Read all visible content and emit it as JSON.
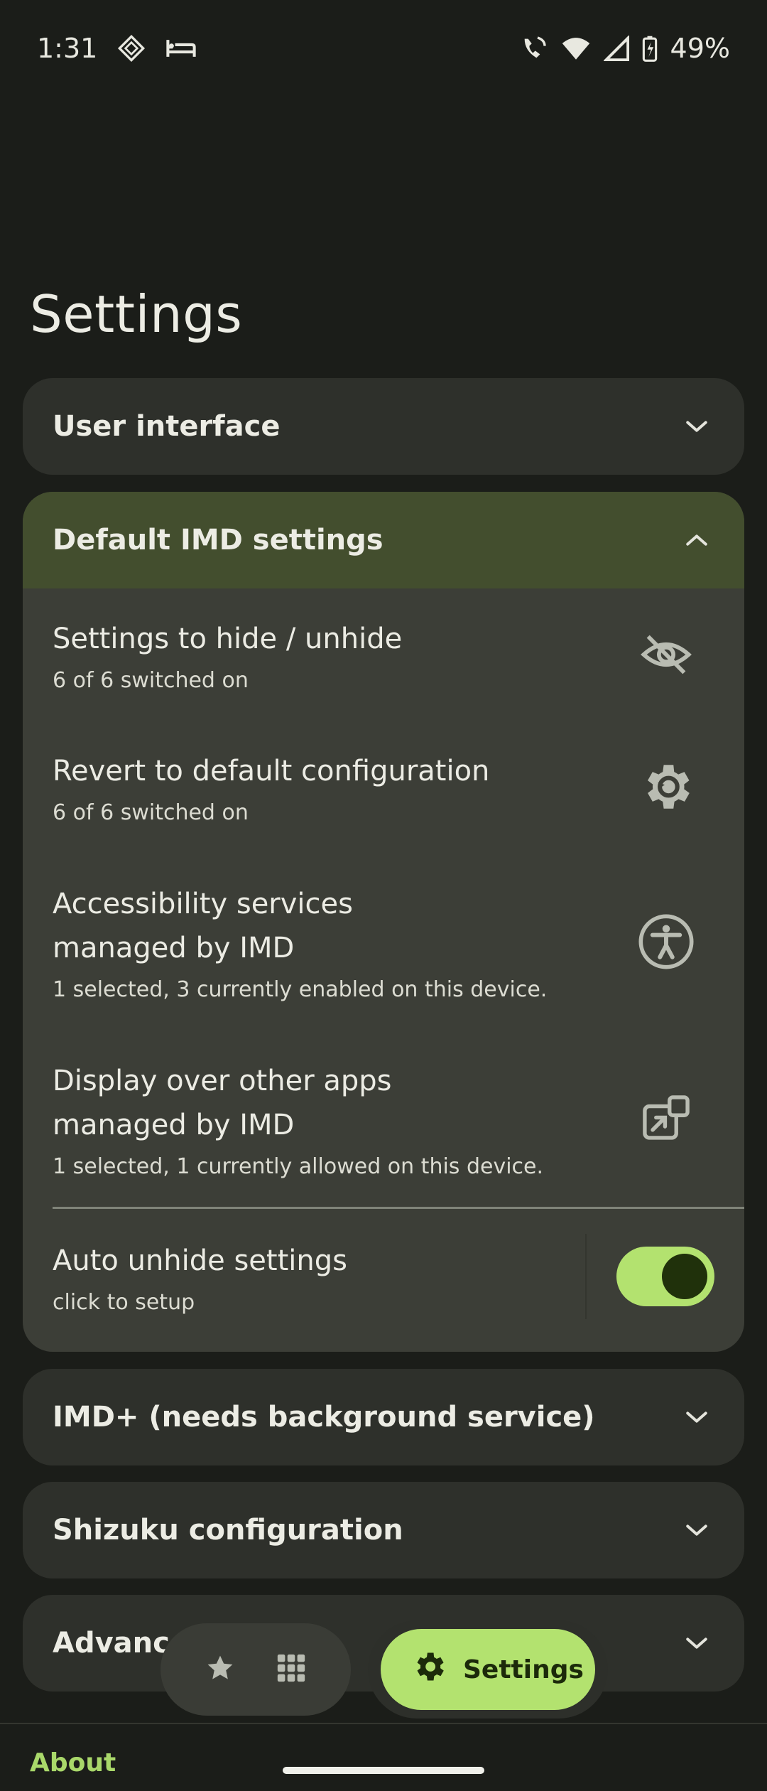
{
  "status_bar": {
    "time": "1:31",
    "battery": "49%"
  },
  "page": {
    "title": "Settings"
  },
  "sections": {
    "user_interface": {
      "label": "User interface"
    },
    "default_imd": {
      "label": "Default IMD settings",
      "items": [
        {
          "title": "Settings to hide / unhide",
          "subtitle": "6 of 6 switched on",
          "icon": "eye-off-icon"
        },
        {
          "title": "Revert to default configuration",
          "subtitle": "6 of 6 switched on",
          "icon": "gear-restore-icon"
        },
        {
          "title_line1": "Accessibility services",
          "title_line2": "managed by IMD",
          "subtitle": "1 selected, 3 currently enabled on this device.",
          "icon": "accessibility-icon"
        },
        {
          "title_line1": "Display over other apps",
          "title_line2": "managed by IMD",
          "subtitle": "1 selected, 1 currently allowed on this device.",
          "icon": "open-in-window-icon"
        }
      ],
      "auto_unhide": {
        "title": "Auto unhide settings",
        "subtitle": "click to setup",
        "enabled": true
      }
    },
    "imd_plus": {
      "label": "IMD+ (needs background service)"
    },
    "shizuku": {
      "label": "Shizuku configuration"
    },
    "advanced": {
      "label": "Advanced"
    }
  },
  "nav": {
    "settings_label": "Settings"
  },
  "footer": {
    "about": "About"
  },
  "colors": {
    "accent": "#b3e26f",
    "expanded_header": "#434e2e",
    "card": "#2e302b",
    "background": "#1b1d19"
  }
}
